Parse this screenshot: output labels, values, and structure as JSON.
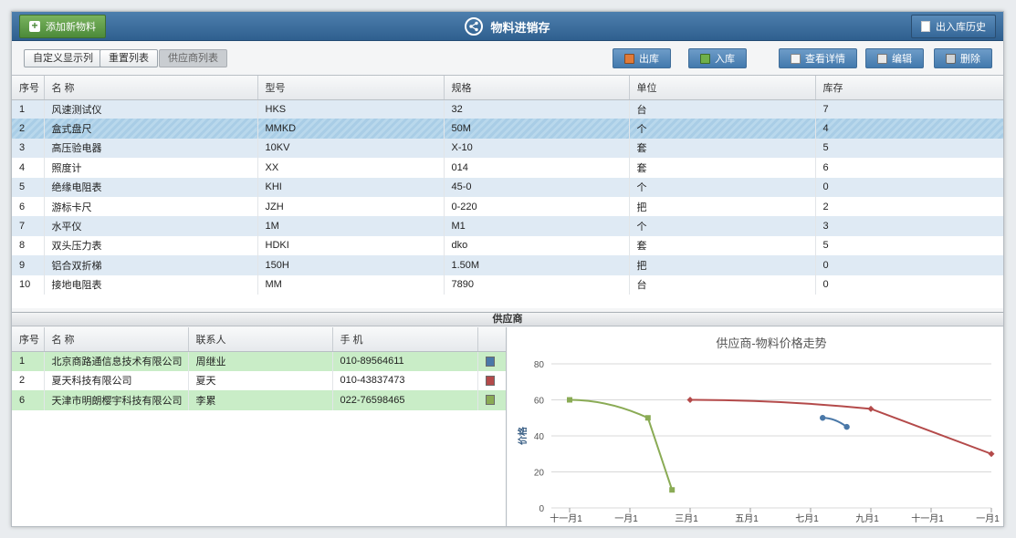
{
  "header": {
    "add_label": "添加新物料",
    "title": "物料进销存",
    "history_label": "出入库历史"
  },
  "toolbar": {
    "custom_cols": "自定义显示列",
    "reset_cols": "重置列表",
    "supplier_list": "供应商列表",
    "out": "出库",
    "in": "入库",
    "details": "查看详情",
    "edit": "编辑",
    "delete": "删除"
  },
  "main_grid": {
    "columns": [
      "序号",
      "名  称",
      "型号",
      "规格",
      "单位",
      "库存"
    ],
    "rows": [
      [
        "1",
        "风速测试仪",
        "HKS",
        "32",
        "台",
        "7"
      ],
      [
        "2",
        "盒式盘尺",
        "MMKD",
        "50M",
        "个",
        "4"
      ],
      [
        "3",
        "高压验电器",
        "10KV",
        "X-10",
        "套",
        "5"
      ],
      [
        "4",
        "照度计",
        "XX",
        "014",
        "套",
        "6"
      ],
      [
        "5",
        "绝缘电阻表",
        "KHI",
        "45-0",
        "个",
        "0"
      ],
      [
        "6",
        "游标卡尺",
        "JZH",
        "0-220",
        "把",
        "2"
      ],
      [
        "7",
        "水平仪",
        "1M",
        "M1",
        "个",
        "3"
      ],
      [
        "8",
        "双头压力表",
        "HDKI",
        "dko",
        "套",
        "5"
      ],
      [
        "9",
        "铝合双折梯",
        "150H",
        "1.50M",
        "把",
        "0"
      ],
      [
        "10",
        "接地电阻表",
        "MM",
        "7890",
        "台",
        "0"
      ]
    ]
  },
  "supplier": {
    "section_title": "供应商",
    "columns": [
      "序号",
      "名  称",
      "联系人",
      "手  机"
    ],
    "rows": [
      [
        "1",
        "北京商路通信息技术有限公司",
        "周继业",
        "010-89564611"
      ],
      [
        "2",
        "夏天科技有限公司",
        "夏天",
        "010-43837473"
      ],
      [
        "6",
        "天津市明朗樱宇科技有限公司",
        "李累",
        "022-76598465"
      ]
    ],
    "swatches": [
      "#4a78a8",
      "#b44a4a",
      "#8aab55"
    ]
  },
  "chart_data": {
    "type": "line",
    "title": "供应商-物料价格走势",
    "ylabel": "价格",
    "ylim": [
      0,
      80
    ],
    "yticks": [
      0,
      20,
      40,
      60,
      80
    ],
    "xticks": [
      "十一月1",
      "一月1",
      "三月1",
      "五月1",
      "七月1",
      "九月1",
      "十一月1",
      "一月1"
    ],
    "series": [
      {
        "color": "#8aab55",
        "points": [
          [
            0,
            60
          ],
          [
            1.3,
            50
          ],
          [
            1.7,
            10
          ]
        ]
      },
      {
        "color": "#b44a4a",
        "points": [
          [
            2.0,
            60
          ],
          [
            5.0,
            55
          ],
          [
            7.0,
            30
          ]
        ]
      },
      {
        "color": "#4a78a8",
        "points": [
          [
            4.2,
            50
          ],
          [
            4.6,
            45
          ]
        ]
      }
    ]
  }
}
